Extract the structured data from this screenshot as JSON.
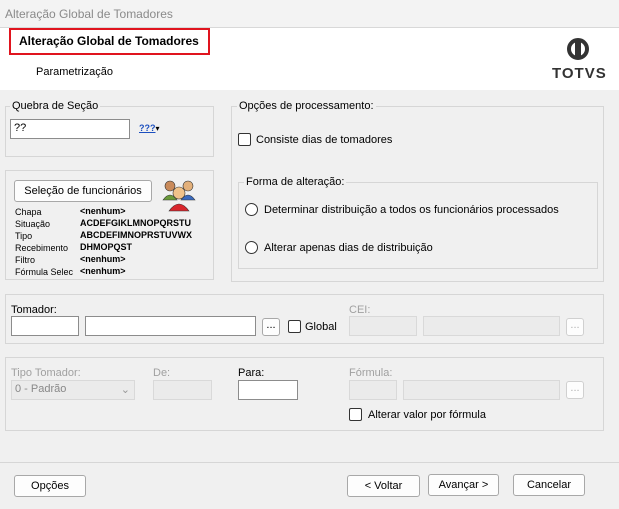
{
  "window": {
    "title": "Alteração Global de Tomadores"
  },
  "header": {
    "title": "Alteração Global de Tomadores",
    "subtitle": "Parametrização",
    "logo_text": "TOTVS"
  },
  "quebra": {
    "legend": "Quebra de Seção",
    "value": "??",
    "dropdown_label": "???"
  },
  "selecao": {
    "button_label": "Seleção de funcionários",
    "rows": [
      {
        "label": "Chapa",
        "value": "<nenhum>"
      },
      {
        "label": "Situação",
        "value": "ACDEFGIKLMNOPQRSTU"
      },
      {
        "label": "Tipo",
        "value": "ABCDEFIMNOPRSTUVWX"
      },
      {
        "label": "Recebimento",
        "value": "DHMOPQST"
      },
      {
        "label": "Filtro",
        "value": "<nenhum>"
      },
      {
        "label": "Fórmula Selec",
        "value": "<nenhum>"
      }
    ]
  },
  "opcoes": {
    "legend": "Opções de processamento:",
    "consiste_label": "Consiste dias de tomadores",
    "forma_legend": "Forma de alteração:",
    "radio1_label": "Determinar distribuição a todos os funcionários processados",
    "radio2_label": "Alterar apenas dias de distribuição"
  },
  "tomador": {
    "label": "Tomador:",
    "ellipsis": "...",
    "global_label": "Global",
    "cei_label": "CEI:",
    "cei_ellipsis": "..."
  },
  "tipo": {
    "tipo_label": "Tipo Tomador:",
    "tipo_value": "0 - Padrão",
    "de_label": "De:",
    "para_label": "Para:",
    "formula_label": "Fórmula:",
    "formula_ellipsis": "...",
    "alterar_label": "Alterar valor por fórmula"
  },
  "footer": {
    "opcoes": "Opções",
    "voltar": "< Voltar",
    "avancar": "Avançar >",
    "cancelar": "Cancelar"
  }
}
